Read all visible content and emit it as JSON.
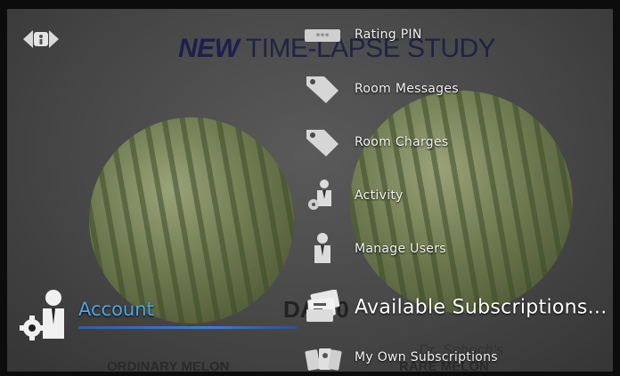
{
  "background": {
    "headline_new": "NEW",
    "headline_rest": "TIME-LAPSE STUDY",
    "day_label": "DAY 0",
    "left_caption": "ORDINARY MELON",
    "right_caption_top": "Dr. Schoch's",
    "right_caption": "RARE MELON"
  },
  "nav": {
    "icon": "back-arrow-icon"
  },
  "account": {
    "label": "Account",
    "icon": "account-settings-icon",
    "accent_color": "#4fa6e6"
  },
  "menu": {
    "items": [
      {
        "label": "Rating PIN",
        "icon": "pin-entry-icon"
      },
      {
        "label": "Room Messages",
        "icon": "tag-icon"
      },
      {
        "label": "Room Charges",
        "icon": "tag-icon"
      },
      {
        "label": "Activity",
        "icon": "person-activity-icon"
      },
      {
        "label": "Manage Users",
        "icon": "person-icon"
      },
      {
        "label": "Available Subscriptions...",
        "icon": "subscription-cards-icon",
        "selected": true
      },
      {
        "label": "My Own Subscriptions",
        "icon": "my-subscriptions-icon"
      }
    ]
  }
}
